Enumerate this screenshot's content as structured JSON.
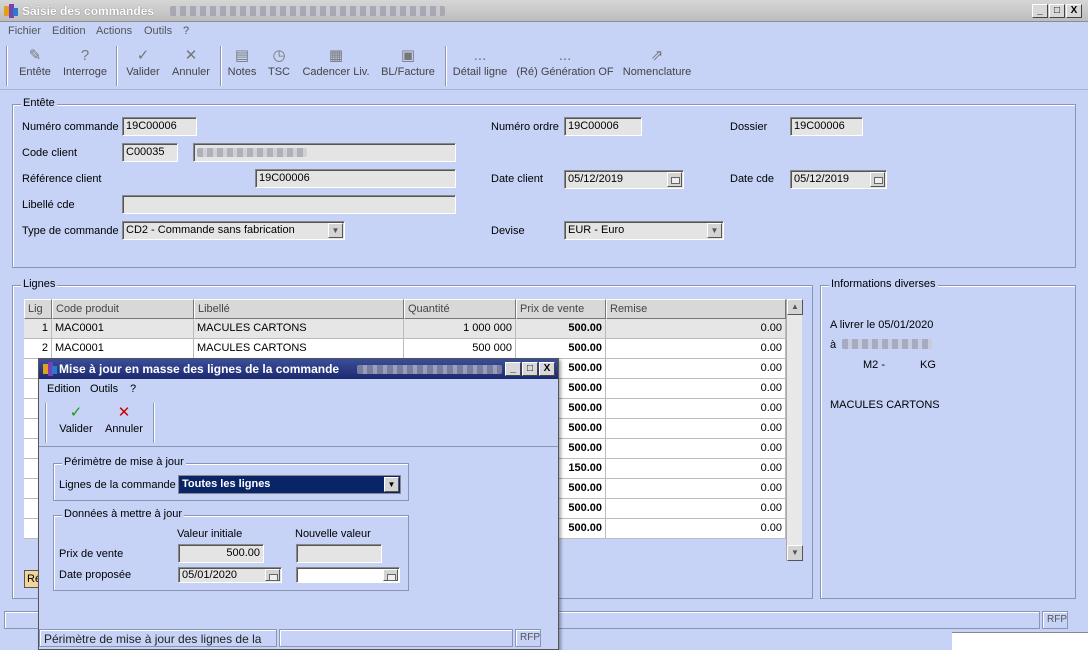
{
  "window": {
    "title": "Saisie des commandes",
    "controls": [
      "_",
      "□",
      "X"
    ]
  },
  "menu": [
    "Fichier",
    "Edition",
    "Actions",
    "Outils",
    "?"
  ],
  "toolbar": {
    "entete": "Entête",
    "interroge": "Interroge",
    "valider": "Valider",
    "annuler": "Annuler",
    "notes": "Notes",
    "tsc": "TSC",
    "cadencer": "Cadencer Liv.",
    "bl": "BL/Facture",
    "detail": "Détail ligne",
    "generation": "(Ré) Génération OF",
    "nomenclature": "Nomenclature",
    "dots": "..."
  },
  "entete": {
    "group": "Entête",
    "numero_commande_label": "Numéro commande",
    "numero_commande": "19C00006",
    "numero_ordre_label": "Numéro ordre",
    "numero_ordre": "19C00006",
    "dossier_label": "Dossier",
    "dossier": "19C00006",
    "code_client_label": "Code client",
    "code_client": "C00035",
    "reference_client_label": "Référence client",
    "reference_client": "19C00006",
    "date_client_label": "Date client",
    "date_client": "05/12/2019",
    "date_cde_label": "Date cde",
    "date_cde": "05/12/2019",
    "libelle_cde_label": "Libellé cde",
    "libelle_cde": "",
    "type_commande_label": "Type de commande",
    "type_commande": "CD2 - Commande sans fabrication",
    "devise_label": "Devise",
    "devise": "EUR - Euro"
  },
  "lignes": {
    "group": "Lignes",
    "columns": [
      "Lig",
      "Code produit",
      "Libellé",
      "Quantité",
      "Prix de vente",
      "Remise"
    ],
    "rows": [
      {
        "lig": "1",
        "code": "MAC0001",
        "libelle": "MACULES CARTONS",
        "quantite": "1 000 000",
        "prix": "500.00",
        "remise": "0.00"
      },
      {
        "lig": "2",
        "code": "MAC0001",
        "libelle": "MACULES CARTONS",
        "quantite": "500 000",
        "prix": "500.00",
        "remise": "0.00"
      },
      {
        "lig": "",
        "code": "",
        "libelle": "",
        "quantite": "",
        "prix": "500.00",
        "remise": "0.00"
      },
      {
        "lig": "",
        "code": "",
        "libelle": "",
        "quantite": "",
        "prix": "500.00",
        "remise": "0.00"
      },
      {
        "lig": "",
        "code": "",
        "libelle": "",
        "quantite": "",
        "prix": "500.00",
        "remise": "0.00"
      },
      {
        "lig": "",
        "code": "",
        "libelle": "",
        "quantite": "",
        "prix": "500.00",
        "remise": "0.00"
      },
      {
        "lig": "",
        "code": "",
        "libelle": "",
        "quantite": "",
        "prix": "500.00",
        "remise": "0.00"
      },
      {
        "lig": "",
        "code": "",
        "libelle": "",
        "quantite": "",
        "prix": "150.00",
        "remise": "0.00"
      },
      {
        "lig": "",
        "code": "",
        "libelle": "",
        "quantite": "",
        "prix": "500.00",
        "remise": "0.00"
      },
      {
        "lig": "",
        "code": "",
        "libelle": "",
        "quantite": "",
        "prix": "500.00",
        "remise": "0.00"
      },
      {
        "lig": "",
        "code": "",
        "libelle": "",
        "quantite": "",
        "prix": "500.00",
        "remise": "0.00"
      }
    ],
    "footer_button": "Ré"
  },
  "infos": {
    "group": "Informations diverses",
    "livrer": "A livrer le 05/01/2020",
    "a": "à",
    "unit1": "M2 -",
    "unit2": "KG",
    "produit": "MACULES CARTONS"
  },
  "status": {
    "rfp": "RFP"
  },
  "dialog": {
    "title": "Mise à jour en masse des lignes de la commande",
    "menu": [
      "Edition",
      "Outils",
      "?"
    ],
    "valider": "Valider",
    "annuler": "Annuler",
    "perimetre_group": "Périmètre de mise à jour",
    "lignes_label": "Lignes de la commande",
    "lignes_value": "Toutes les lignes",
    "donnees_group": "Données à mettre à jour",
    "valeur_initiale": "Valeur initiale",
    "nouvelle_valeur": "Nouvelle valeur",
    "prix_label": "Prix de vente",
    "prix_initial": "500.00",
    "prix_nouveau": "",
    "date_label": "Date proposée",
    "date_initiale": "05/01/2020",
    "date_nouvelle": "",
    "status_text": "Périmètre de mise à jour des lignes de la",
    "rfp": "RFP"
  }
}
